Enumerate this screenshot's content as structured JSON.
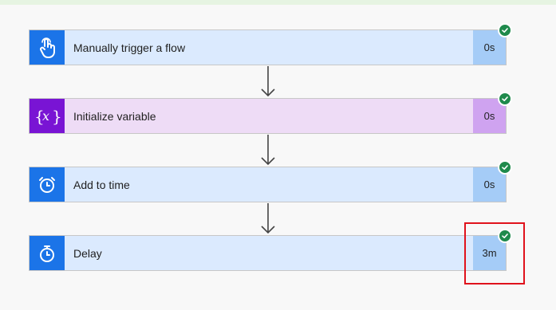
{
  "flow": {
    "steps": [
      {
        "title": "Manually trigger a flow",
        "duration": "0s",
        "icon": "hand-touch-icon",
        "status": "succeeded",
        "color": "#1b74e8"
      },
      {
        "title": "Initialize variable",
        "duration": "0s",
        "icon": "variable-icon",
        "status": "succeeded",
        "color": "#7914d4"
      },
      {
        "title": "Add to time",
        "duration": "0s",
        "icon": "alarm-clock-icon",
        "status": "succeeded",
        "color": "#1b74e8"
      },
      {
        "title": "Delay",
        "duration": "3m",
        "icon": "stopwatch-icon",
        "status": "succeeded",
        "color": "#1b74e8"
      }
    ],
    "status_color": "#1f8a4c",
    "highlight_color": "#e0121c"
  }
}
